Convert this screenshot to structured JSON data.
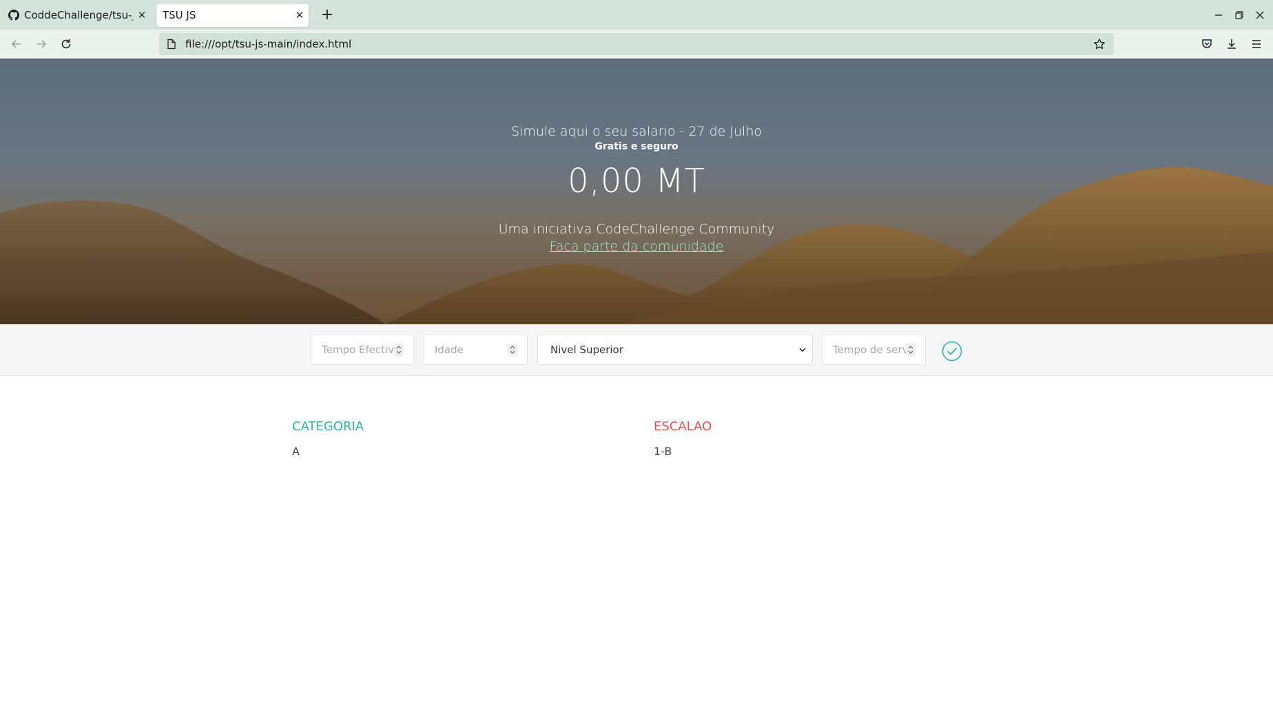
{
  "browser": {
    "tabs": [
      {
        "label": "CoddeChallenge/tsu-js",
        "active": false
      },
      {
        "label": "TSU JS",
        "active": true
      }
    ],
    "url": "file:///opt/tsu-js-main/index.html"
  },
  "hero": {
    "title": "Simule aqui o seu salario - 27 de Julho",
    "subtitle": "Gratis e seguro",
    "amount": "0,00 MT",
    "initiative": "Uma iniciativa CodeChallenge Community",
    "link": "Faca parte da comunidade"
  },
  "form": {
    "tempo_efectivo_placeholder": "Tempo Efectivo",
    "idade_placeholder": "Idade",
    "nivel_selected": "Nivel Superior",
    "tempo_servico_placeholder": "Tempo de servico"
  },
  "results": {
    "categoria_label": "CATEGORIA",
    "categoria_value": "A",
    "escalao_label": "ESCALAO",
    "escalao_value": "1-B"
  },
  "colors": {
    "accent": "#2bb5a8",
    "escalao": "#e4534f",
    "link": "#a7e8d3"
  }
}
